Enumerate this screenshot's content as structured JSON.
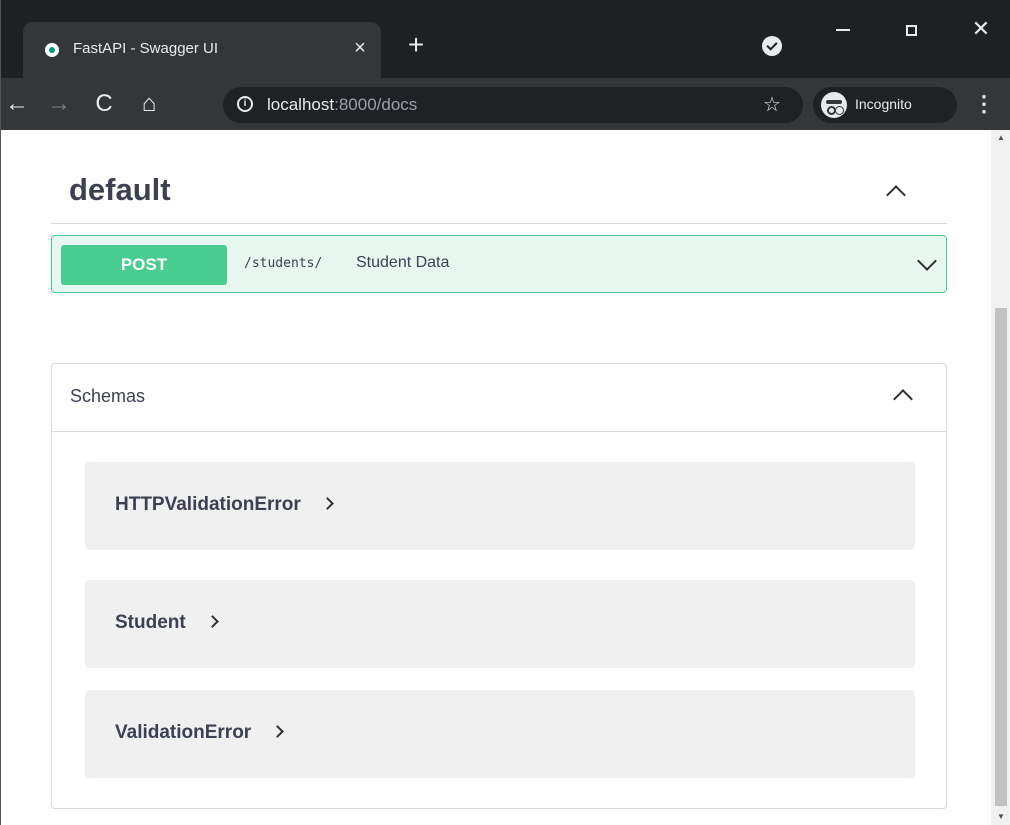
{
  "browser": {
    "tab_title": "FastAPI - Swagger UI",
    "tab_close": "×",
    "new_tab": "+",
    "url_host": "localhost",
    "url_path": ":8000/docs",
    "profile_label": "Incognito",
    "window_close": "✕",
    "nav_back": "←",
    "nav_forward": "→",
    "nav_reload": "C",
    "nav_home": "⌂",
    "bookmark_star": "☆",
    "menu": "⋮"
  },
  "tag": {
    "name": "default"
  },
  "operation": {
    "method": "POST",
    "path": "/students/",
    "summary": "Student Data"
  },
  "schemas": {
    "title": "Schemas",
    "items": [
      {
        "name": "HTTPValidationError"
      },
      {
        "name": "Student"
      },
      {
        "name": "ValidationError"
      }
    ]
  },
  "colors": {
    "post_method": "#49cc90",
    "post_background": "#e8f6f0",
    "text": "#3b4151",
    "browser_frame": "#1f2023",
    "browser_toolbar": "#35363a"
  }
}
